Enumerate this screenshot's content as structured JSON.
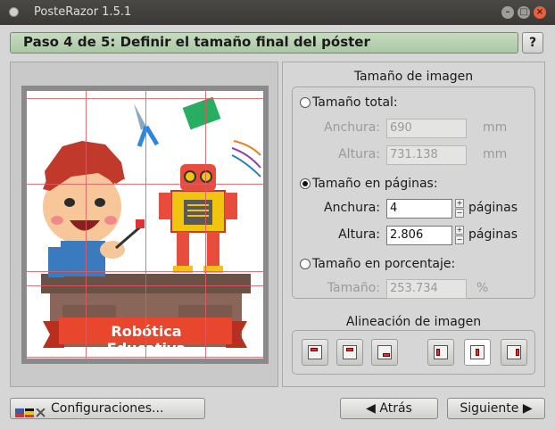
{
  "window": {
    "title": "PosteRazor 1.5.1"
  },
  "step": {
    "title": "Paso 4 de 5: Definir el tamaño final del póster",
    "help_label": "?"
  },
  "preview": {
    "poster_banner": "Robótica Educativa"
  },
  "image_size": {
    "section_title": "Tamaño de imagen",
    "total": {
      "label": "Tamaño total:",
      "selected": false,
      "width_label": "Anchura:",
      "width_value": "690",
      "width_unit": "mm",
      "height_label": "Altura:",
      "height_value": "731.138",
      "height_unit": "mm"
    },
    "pages": {
      "label": "Tamaño en páginas:",
      "selected": true,
      "width_label": "Anchura:",
      "width_value": "4",
      "width_unit": "páginas",
      "height_label": "Altura:",
      "height_value": "2.806",
      "height_unit": "páginas"
    },
    "percent": {
      "label": "Tamaño en porcentaje:",
      "selected": false,
      "size_label": "Tamaño:",
      "size_value": "253.734",
      "size_unit": "%"
    }
  },
  "alignment": {
    "section_title": "Alineación de imagen",
    "selected": "center"
  },
  "footer": {
    "settings_label": "Configuraciones...",
    "back_label": "Atrás",
    "next_label": "Siguiente"
  },
  "icons": [
    "app-icon",
    "minimize-icon",
    "maximize-icon",
    "close-icon",
    "flags-tools-icon",
    "arrow-left-icon",
    "arrow-right-icon"
  ]
}
